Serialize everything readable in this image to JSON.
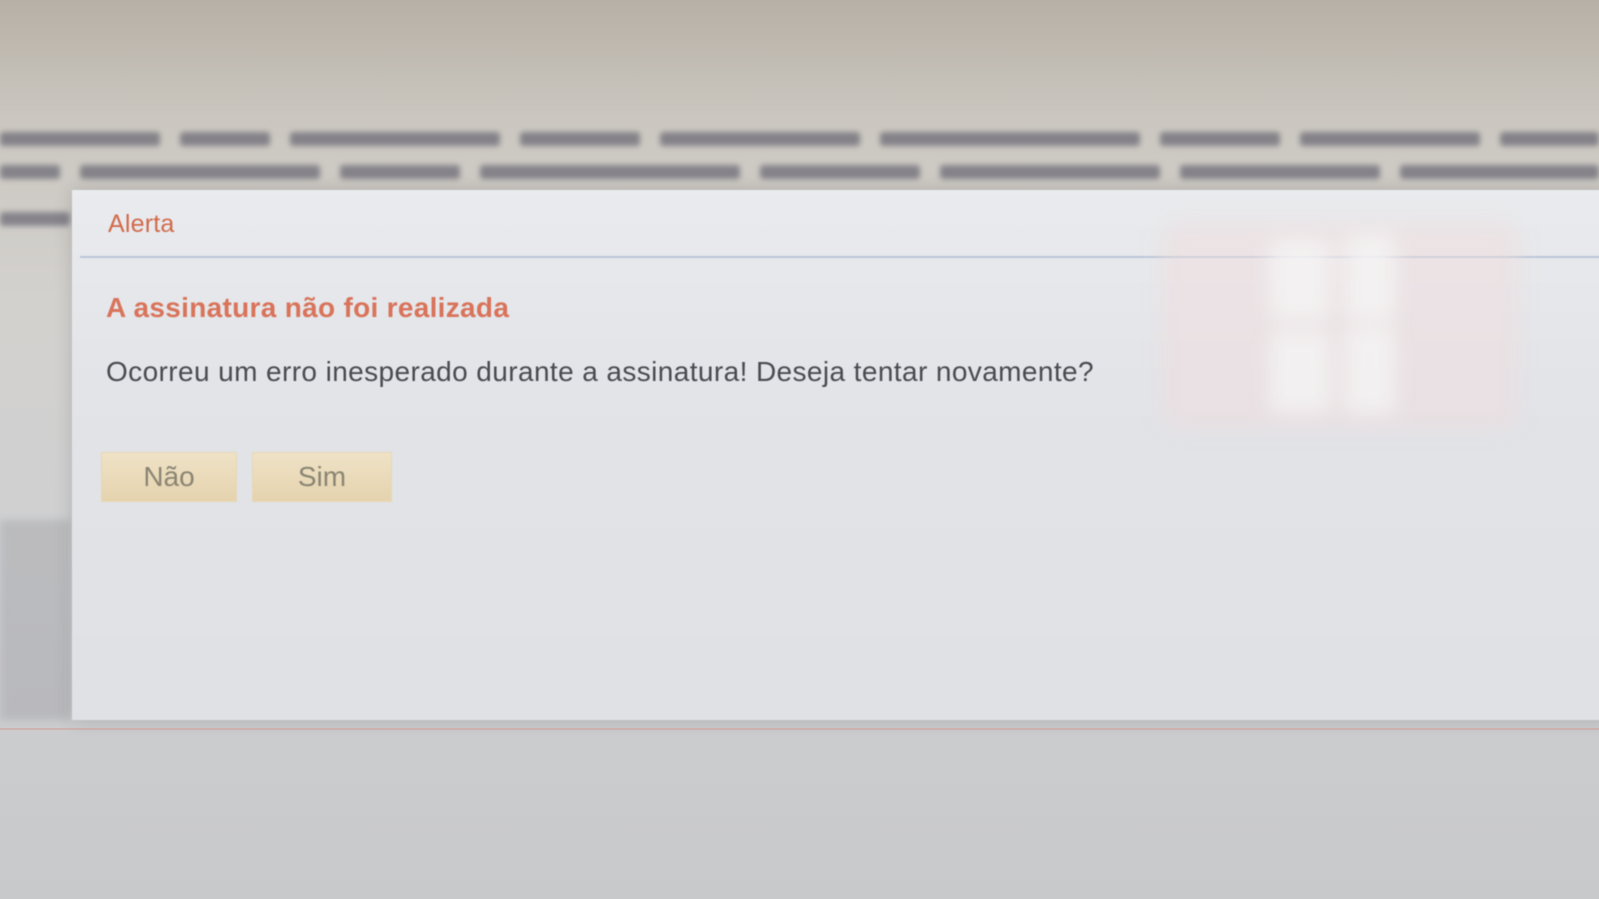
{
  "dialog": {
    "title": "Alerta",
    "heading": "A assinatura não foi realizada",
    "message": "Ocorreu um erro inesperado durante a assinatura! Deseja tentar novamente?",
    "buttons": {
      "no_label": "Não",
      "yes_label": "Sim"
    }
  },
  "colors": {
    "accent": "#d26a4a",
    "button_bg": "#e9d9b8",
    "dialog_bg": "#e6e8eb"
  }
}
